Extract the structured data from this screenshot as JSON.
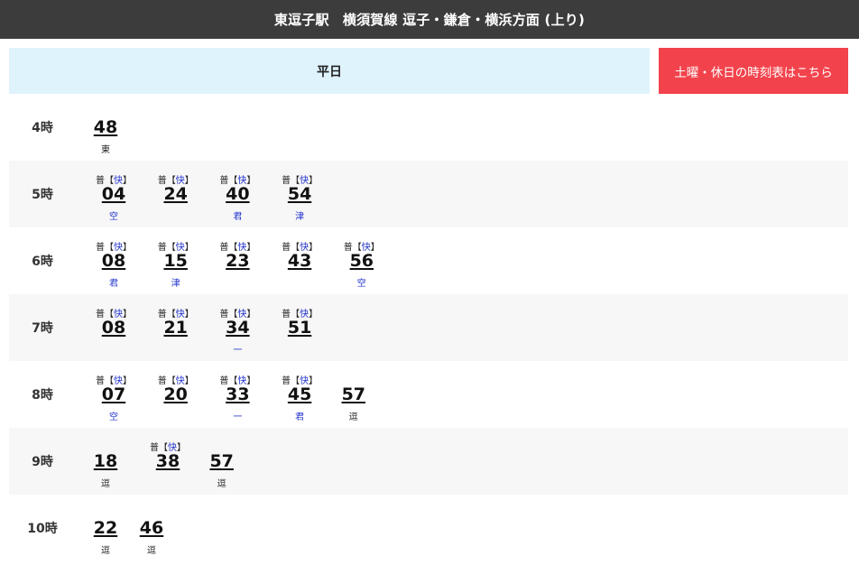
{
  "header": {
    "title": "東逗子駅　横須賀線 逗子・鎌倉・横浜方面 (上り)"
  },
  "tabs": {
    "weekday": "平日",
    "holiday": "土曜・休日の時刻表はこちら"
  },
  "colors": {
    "header_bg": "#3c3c3c",
    "weekday_bg": "#dff3fd",
    "holiday_bg": "#f2434c",
    "rapid_text": "#2233cc"
  },
  "rows": [
    {
      "hour": "4時",
      "trains": [
        {
          "type": "",
          "minute": "48",
          "dest": "東"
        }
      ]
    },
    {
      "hour": "5時",
      "trains": [
        {
          "type": "普",
          "rapid": "快",
          "minute": "04",
          "dest": "空"
        },
        {
          "type": "普",
          "rapid": "快",
          "minute": "24",
          "dest": ""
        },
        {
          "type": "普",
          "rapid": "快",
          "minute": "40",
          "dest": "君"
        },
        {
          "type": "普",
          "rapid": "快",
          "minute": "54",
          "dest": "津"
        }
      ]
    },
    {
      "hour": "6時",
      "trains": [
        {
          "type": "普",
          "rapid": "快",
          "minute": "08",
          "dest": "君"
        },
        {
          "type": "普",
          "rapid": "快",
          "minute": "15",
          "dest": "津"
        },
        {
          "type": "普",
          "rapid": "快",
          "minute": "23",
          "dest": ""
        },
        {
          "type": "普",
          "rapid": "快",
          "minute": "43",
          "dest": ""
        },
        {
          "type": "普",
          "rapid": "快",
          "minute": "56",
          "dest": "空"
        }
      ]
    },
    {
      "hour": "7時",
      "trains": [
        {
          "type": "普",
          "rapid": "快",
          "minute": "08",
          "dest": ""
        },
        {
          "type": "普",
          "rapid": "快",
          "minute": "21",
          "dest": ""
        },
        {
          "type": "普",
          "rapid": "快",
          "minute": "34",
          "dest": "一"
        },
        {
          "type": "普",
          "rapid": "快",
          "minute": "51",
          "dest": ""
        }
      ]
    },
    {
      "hour": "8時",
      "trains": [
        {
          "type": "普",
          "rapid": "快",
          "minute": "07",
          "dest": "空"
        },
        {
          "type": "普",
          "rapid": "快",
          "minute": "20",
          "dest": ""
        },
        {
          "type": "普",
          "rapid": "快",
          "minute": "33",
          "dest": "一"
        },
        {
          "type": "普",
          "rapid": "快",
          "minute": "45",
          "dest": "君"
        },
        {
          "type": "",
          "minute": "57",
          "dest": "逗"
        }
      ]
    },
    {
      "hour": "9時",
      "trains": [
        {
          "type": "",
          "minute": "18",
          "dest": "逗"
        },
        {
          "type": "普",
          "rapid": "快",
          "minute": "38",
          "dest": ""
        },
        {
          "type": "",
          "minute": "57",
          "dest": "逗"
        }
      ]
    },
    {
      "hour": "10時",
      "trains": [
        {
          "type": "",
          "minute": "22",
          "dest": "逗"
        },
        {
          "type": "",
          "minute": "46",
          "dest": "逗"
        }
      ]
    }
  ]
}
